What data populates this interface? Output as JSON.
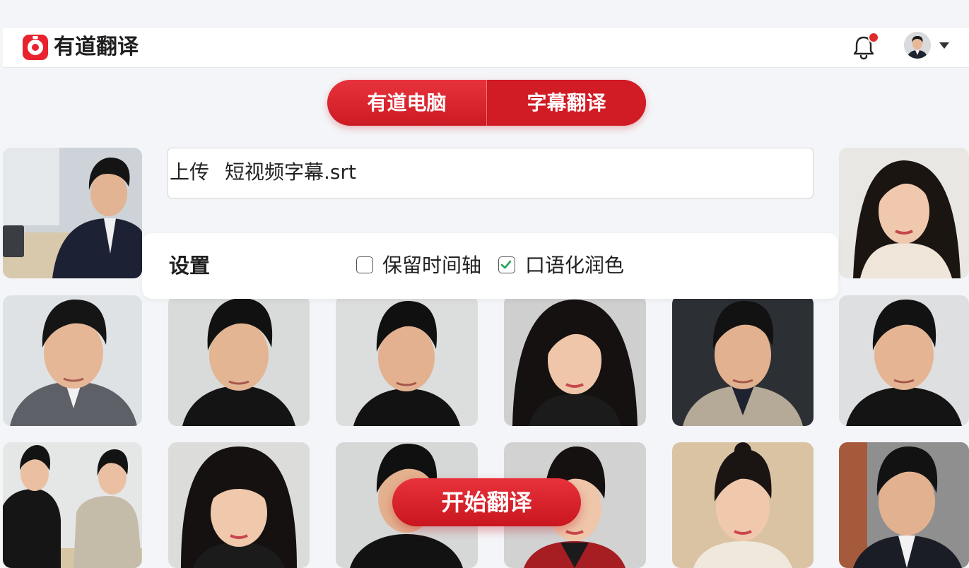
{
  "app": {
    "brand": "有道翻译",
    "accent": "#e8232d"
  },
  "header": {
    "notification_icon": "bell-icon",
    "avatar_icon": "user-avatar",
    "menu_icon": "chevron-down-icon"
  },
  "tabs": [
    {
      "label": "有道电脑"
    },
    {
      "label": "字幕翻译",
      "selected": true
    }
  ],
  "upload": {
    "label": "上传",
    "filename": "短视频字幕.srt"
  },
  "settings": {
    "label": "设置",
    "options": [
      {
        "label": "保留时间轴",
        "checked": false
      },
      {
        "label": "口语化润色",
        "checked": true
      }
    ]
  },
  "actions": {
    "start_label": "开始翻译"
  }
}
